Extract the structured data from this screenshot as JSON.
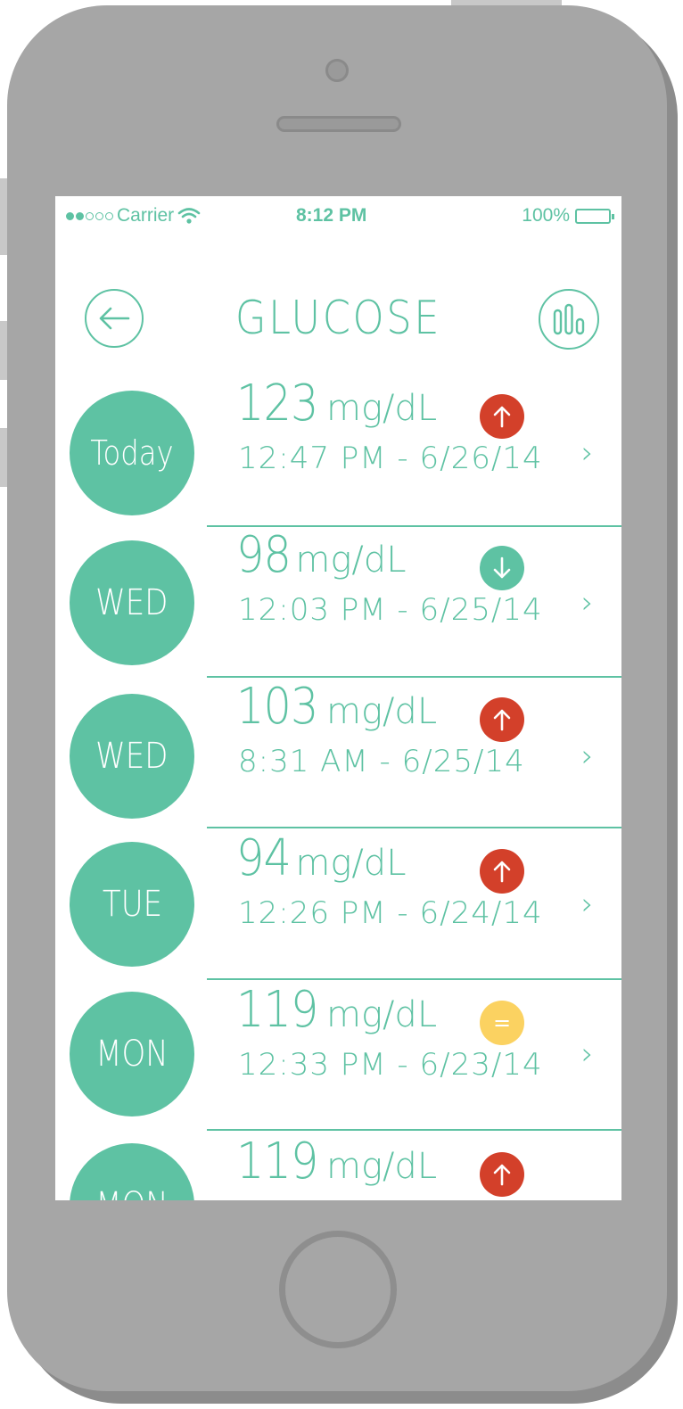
{
  "status_bar": {
    "carrier": "Carrier",
    "time": "8:12 PM",
    "battery": "100%"
  },
  "header": {
    "title": "GLUCOSE",
    "back_icon": "arrow-left-icon",
    "chart_icon": "bar-chart-icon"
  },
  "readings": [
    {
      "day": "Today",
      "value": "123",
      "unit": "mg/dL",
      "time": "12:47 PM - 6/26/14",
      "trend": "up"
    },
    {
      "day": "WED",
      "value": "98",
      "unit": "mg/dL",
      "time": "12:03 PM - 6/25/14",
      "trend": "down"
    },
    {
      "day": "WED",
      "value": "103",
      "unit": "mg/dL",
      "time": "8:31 AM - 6/25/14",
      "trend": "up"
    },
    {
      "day": "TUE",
      "value": "94",
      "unit": "mg/dL",
      "time": "12:26 PM - 6/24/14",
      "trend": "up"
    },
    {
      "day": "MON",
      "value": "119",
      "unit": "mg/dL",
      "time": "12:33 PM - 6/23/14",
      "trend": "equal"
    },
    {
      "day": "MON",
      "value": "119",
      "unit": "mg/dL",
      "time": "",
      "trend": "up"
    }
  ],
  "colors": {
    "accent": "#5ec2a3",
    "up": "#d3402a",
    "down": "#5ec2a3",
    "equal": "#fbd261",
    "phone_body": "#a6a6a6"
  }
}
